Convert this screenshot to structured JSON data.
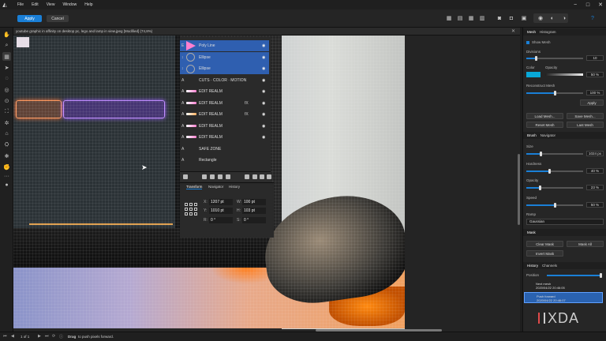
{
  "menubar": {
    "items": [
      "File",
      "Edit",
      "View",
      "Window",
      "Help"
    ],
    "window_controls": [
      "−",
      "□",
      "✕"
    ]
  },
  "toolbar": {
    "apply_label": "Apply",
    "cancel_label": "Cancel",
    "accent": "#1a7fd6"
  },
  "document": {
    "title": "youtube graphic in affinity on desktop pc, lego and lamp in view.jpeg [Modified] (74,8%)",
    "close": "✕"
  },
  "layers": [
    {
      "type": "E",
      "name": "Poly Line",
      "selected": true,
      "thumb": "tri",
      "fx": "",
      "eye": "◉"
    },
    {
      "type": "↕",
      "name": "Ellipse",
      "selected": true,
      "thumb": "circle",
      "fx": "",
      "eye": "◉"
    },
    {
      "type": "↕",
      "name": "Ellipse",
      "selected": true,
      "thumb": "circle",
      "fx": "",
      "eye": "◉"
    },
    {
      "type": "A",
      "name": "CUTS · COLOR · MOTION",
      "selected": false,
      "thumb": "none",
      "fx": "",
      "eye": "◉"
    },
    {
      "type": "A",
      "name": "EDIT REALM",
      "selected": false,
      "thumb": "bar-pink",
      "fx": "",
      "eye": "◉"
    },
    {
      "type": "A",
      "name": "EDIT REALM",
      "selected": false,
      "thumb": "bar-pink",
      "fx": "fX",
      "eye": "◉"
    },
    {
      "type": "A",
      "name": "EDIT REALM",
      "selected": false,
      "thumb": "bar-orange",
      "fx": "fX",
      "eye": "◉"
    },
    {
      "type": "A",
      "name": "EDIT REALM",
      "selected": false,
      "thumb": "bar-pink",
      "fx": "",
      "eye": "◉"
    },
    {
      "type": "A",
      "name": "EDIT REALM",
      "selected": false,
      "thumb": "bar-pink",
      "fx": "",
      "eye": "◉"
    },
    {
      "type": "A",
      "name": "SAFE ZONE",
      "selected": false,
      "thumb": "none",
      "fx": "",
      "eye": ""
    },
    {
      "type": "A",
      "name": "Rectangle",
      "selected": false,
      "thumb": "none",
      "fx": "",
      "eye": ""
    }
  ],
  "transform_panel": {
    "tabs": [
      "Transform",
      "Navigator",
      "History"
    ],
    "active_tab": "Transform",
    "x_label": "X:",
    "x_value": "1207 pt",
    "y_label": "Y:",
    "y_value": "1010 pt",
    "w_label": "W:",
    "w_value": "100 pt",
    "h_label": "H:",
    "h_value": "103 pt",
    "r_label": "R:",
    "r_value": "0 °",
    "s_label": "S:",
    "s_value": "0 °"
  },
  "studio": {
    "mesh": {
      "tabs": [
        "Mesh",
        "Histogram"
      ],
      "show_mesh_label": "Show Mesh",
      "divisions_label": "Divisions",
      "divisions_value": "10",
      "color_label": "Color",
      "opacity_label": "Opacity",
      "opacity_value": "50 %",
      "mesh_color": "#08a8d8",
      "reconstruct_label": "Reconstruct Mesh",
      "reconstruct_value": "100 %",
      "apply_label": "Apply",
      "load_mesh": "Load Mesh...",
      "save_mesh": "Save Mesh...",
      "reset_mesh": "Reset Mesh",
      "last_mesh": "Last Mesh"
    },
    "brush": {
      "tabs": [
        "Brush",
        "Navigator"
      ],
      "size_label": "Size",
      "size_value": "1024 px",
      "hardness_label": "Hardness",
      "hardness_value": "40 %",
      "opacity_label": "Opacity",
      "opacity_value": "23 %",
      "speed_label": "Speed",
      "speed_value": "50 %",
      "ramp_label": "Ramp",
      "ramp_value": "Gaussian"
    },
    "mask": {
      "tab": "Mask",
      "clear_mask": "Clear Mask",
      "mask_all": "Mask All",
      "invert_mask": "Invert Mask"
    },
    "history": {
      "tabs": [
        "History",
        "Channels"
      ],
      "position_label": "Position",
      "items": [
        {
          "name": "Next mesh",
          "time": "2020/04/22 20:46:05"
        },
        {
          "name": "Push forward",
          "time": "2020/04/22 20:46:07"
        }
      ]
    }
  },
  "statusbar": {
    "page_info": "1 of 1",
    "hint_bold": "Drag",
    "hint_rest": "to push pixels forward."
  },
  "watermark": "XDA"
}
